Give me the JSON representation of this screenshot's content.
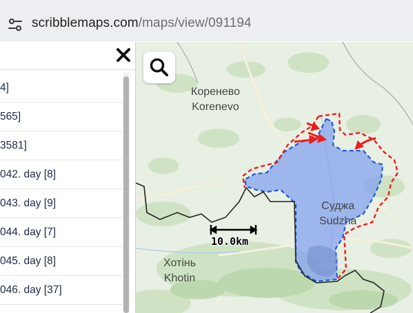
{
  "browser": {
    "url_domain": "scribblemaps.com",
    "url_path": "/maps/view/091194"
  },
  "sidebar": {
    "items": [
      {
        "label": "4]"
      },
      {
        "label": "565]"
      },
      {
        "label": "3581]"
      },
      {
        "label": "042. day [8]"
      },
      {
        "label": "043. day [9]"
      },
      {
        "label": "044. day [7]"
      },
      {
        "label": "045. day [8]"
      },
      {
        "label": "046. day [37]"
      }
    ]
  },
  "map": {
    "places": {
      "korenevo_ru": "Коренево",
      "korenevo_en": "Korenevo",
      "sudzha_ru": "Суджа",
      "sudzha_en": "Sudzha",
      "khotin_ua": "Хотінь",
      "khotin_en": "Khotin"
    },
    "scale_label": "10.0km",
    "colors": {
      "controlled_area_fill": "#7f9ff0",
      "controlled_area_border": "#1e5ad8",
      "contested_line": "#ee1c1c",
      "arrows": "#ee1c1c",
      "border_line": "#222222"
    }
  }
}
